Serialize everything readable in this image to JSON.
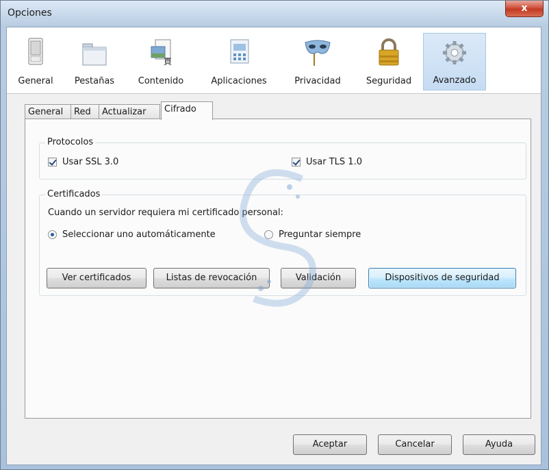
{
  "window": {
    "title": "Opciones",
    "close_glyph": "x"
  },
  "toolbar": {
    "panes": [
      {
        "label": "General",
        "icon": "switch-icon"
      },
      {
        "label": "Pestañas",
        "icon": "tabs-window-icon"
      },
      {
        "label": "Contenido",
        "icon": "content-page-icon"
      },
      {
        "label": "Aplicaciones",
        "icon": "applications-icon"
      },
      {
        "label": "Privacidad",
        "icon": "mask-icon"
      },
      {
        "label": "Seguridad",
        "icon": "padlock-icon"
      },
      {
        "label": "Avanzado",
        "icon": "gear-icon"
      }
    ],
    "selected": "Avanzado"
  },
  "tabs": [
    {
      "label": "General"
    },
    {
      "label": "Red"
    },
    {
      "label": "Actualizar"
    },
    {
      "label": "Cifrado"
    }
  ],
  "active_tab": "Cifrado",
  "protocolos": {
    "legend": "Protocolos",
    "ssl_label": "Usar SSL 3.0",
    "ssl_checked": true,
    "tls_label": "Usar TLS 1.0",
    "tls_checked": true
  },
  "certificados": {
    "legend": "Certificados",
    "prompt": "Cuando un servidor requiera mi certificado personal:",
    "radio_auto": "Seleccionar uno automáticamente",
    "radio_ask": "Preguntar siempre",
    "selected_radio": "auto",
    "buttons": {
      "ver": "Ver certificados",
      "revocacion": "Listas de revocación",
      "validacion": "Validación",
      "dispositivos": "Dispositivos de seguridad"
    }
  },
  "footer": {
    "aceptar": "Aceptar",
    "cancelar": "Cancelar",
    "ayuda": "Ayuda"
  },
  "colors": {
    "selected_pane": "#c6dcf3",
    "focus_border": "#3c7fb1",
    "close_red": "#c23a23"
  }
}
